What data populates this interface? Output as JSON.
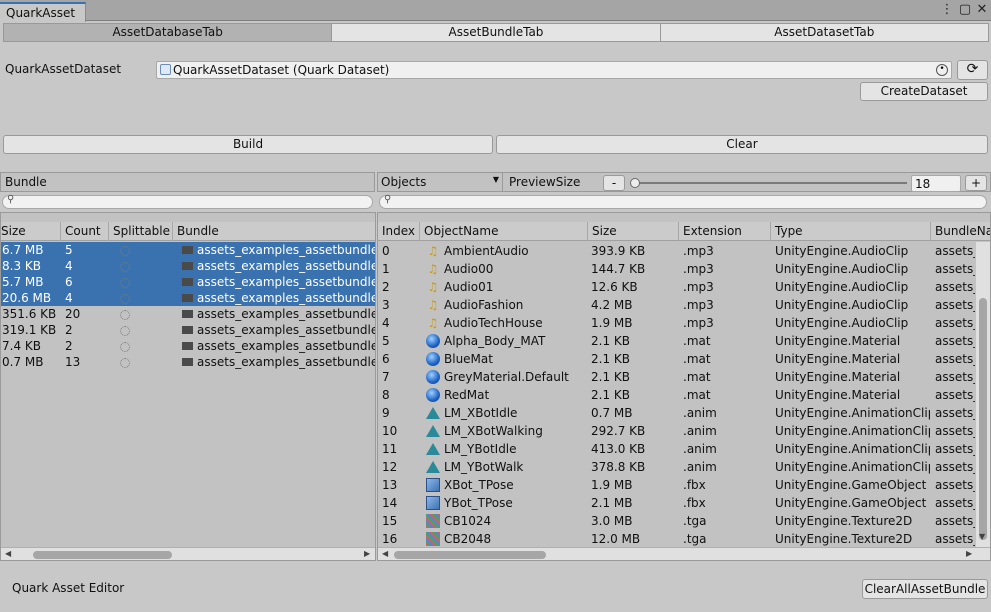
{
  "window": {
    "tab_title": "QuarkAsset",
    "menu_icon": "kebab-menu-icon",
    "maximize_icon": "maximize-icon",
    "close_icon": "close-icon"
  },
  "tabs": [
    {
      "label": "AssetDatabaseTab",
      "selected": true
    },
    {
      "label": "AssetBundleTab",
      "selected": false
    },
    {
      "label": "AssetDatasetTab",
      "selected": false
    }
  ],
  "dataset": {
    "label": "QuarkAssetDataset",
    "value": "QuarkAssetDataset (Quark Dataset)",
    "object_icon": "scriptable-object-icon",
    "picker_icon": "object-picker-icon",
    "refresh_icon": "refresh-icon"
  },
  "buttons": {
    "create_dataset": "CreateDataset",
    "build": "Build",
    "clear": "Clear",
    "clear_all": "ClearAllAssetBundle",
    "minus": "-",
    "plus": "+"
  },
  "bundle_panel": {
    "title": "Bundle",
    "search_icon": "search-icon",
    "columns": [
      "Size",
      "Count",
      "Splittable",
      "Bundle"
    ],
    "rows": [
      {
        "size": "6.7 MB",
        "count": "5",
        "bundle": "assets_examples_assetbundletest_audios",
        "selected": true
      },
      {
        "size": "8.3 KB",
        "count": "4",
        "bundle": "assets_examples_assetbundletest_materials",
        "selected": true
      },
      {
        "size": "5.7 MB",
        "count": "6",
        "bundle": "assets_examples_assetbundletest_models",
        "selected": true
      },
      {
        "size": "20.6 MB",
        "count": "4",
        "bundle": "assets_examples_assetbundletest_textures",
        "selected": true
      },
      {
        "size": "351.6 KB",
        "count": "20",
        "bundle": "assets_examples_assetbundletest_prefabs",
        "selected": false
      },
      {
        "size": "319.1 KB",
        "count": "2",
        "bundle": "assets_examples_assetbundletest_scenes",
        "selected": false
      },
      {
        "size": "7.4 KB",
        "count": "2",
        "bundle": "assets_examples_assetbundletest_scripts",
        "selected": false
      },
      {
        "size": "0.7 MB",
        "count": "13",
        "bundle": "assets_examples_assetbundletest_animations",
        "selected": false
      }
    ]
  },
  "objects_panel": {
    "dropdown_value": "Objects",
    "preview_label": "PreviewSize",
    "preview_value": "18",
    "slider_level": 0.0,
    "search_icon": "search-icon",
    "columns": [
      "Index",
      "ObjectName",
      "Size",
      "Extension",
      "Type",
      "BundleName"
    ],
    "rows": [
      {
        "index": "0",
        "name": "AmbientAudio",
        "icon": "audio",
        "size": "393.9 KB",
        "ext": ".mp3",
        "type": "UnityEngine.AudioClip",
        "bundle": "assets_examples"
      },
      {
        "index": "1",
        "name": "Audio00",
        "icon": "audio",
        "size": "144.7 KB",
        "ext": ".mp3",
        "type": "UnityEngine.AudioClip",
        "bundle": "assets_examples"
      },
      {
        "index": "2",
        "name": "Audio01",
        "icon": "audio",
        "size": "12.6 KB",
        "ext": ".mp3",
        "type": "UnityEngine.AudioClip",
        "bundle": "assets_examples"
      },
      {
        "index": "3",
        "name": "AudioFashion",
        "icon": "audio",
        "size": "4.2 MB",
        "ext": ".mp3",
        "type": "UnityEngine.AudioClip",
        "bundle": "assets_examples"
      },
      {
        "index": "4",
        "name": "AudioTechHouse",
        "icon": "audio",
        "size": "1.9 MB",
        "ext": ".mp3",
        "type": "UnityEngine.AudioClip",
        "bundle": "assets_examples"
      },
      {
        "index": "5",
        "name": "Alpha_Body_MAT",
        "icon": "material",
        "size": "2.1 KB",
        "ext": ".mat",
        "type": "UnityEngine.Material",
        "bundle": "assets_examples"
      },
      {
        "index": "6",
        "name": "BlueMat",
        "icon": "material",
        "size": "2.1 KB",
        "ext": ".mat",
        "type": "UnityEngine.Material",
        "bundle": "assets_examples"
      },
      {
        "index": "7",
        "name": "GreyMaterial.Default",
        "icon": "material",
        "size": "2.1 KB",
        "ext": ".mat",
        "type": "UnityEngine.Material",
        "bundle": "assets_examples"
      },
      {
        "index": "8",
        "name": "RedMat",
        "icon": "material",
        "size": "2.1 KB",
        "ext": ".mat",
        "type": "UnityEngine.Material",
        "bundle": "assets_examples"
      },
      {
        "index": "9",
        "name": "LM_XBotIdle",
        "icon": "anim",
        "size": "0.7 MB",
        "ext": ".anim",
        "type": "UnityEngine.AnimationClip",
        "bundle": "assets_examples"
      },
      {
        "index": "10",
        "name": "LM_XBotWalking",
        "icon": "anim",
        "size": "292.7 KB",
        "ext": ".anim",
        "type": "UnityEngine.AnimationClip",
        "bundle": "assets_examples"
      },
      {
        "index": "11",
        "name": "LM_YBotIdle",
        "icon": "anim",
        "size": "413.0 KB",
        "ext": ".anim",
        "type": "UnityEngine.AnimationClip",
        "bundle": "assets_examples"
      },
      {
        "index": "12",
        "name": "LM_YBotWalk",
        "icon": "anim",
        "size": "378.8 KB",
        "ext": ".anim",
        "type": "UnityEngine.AnimationClip",
        "bundle": "assets_examples"
      },
      {
        "index": "13",
        "name": "XBot_TPose",
        "icon": "model",
        "size": "1.9 MB",
        "ext": ".fbx",
        "type": "UnityEngine.GameObject",
        "bundle": "assets_examples"
      },
      {
        "index": "14",
        "name": "YBot_TPose",
        "icon": "model",
        "size": "2.1 MB",
        "ext": ".fbx",
        "type": "UnityEngine.GameObject",
        "bundle": "assets_examples"
      },
      {
        "index": "15",
        "name": "CB1024",
        "icon": "texture",
        "size": "3.0 MB",
        "ext": ".tga",
        "type": "UnityEngine.Texture2D",
        "bundle": "assets_examples"
      },
      {
        "index": "16",
        "name": "CB2048",
        "icon": "texture",
        "size": "12.0 MB",
        "ext": ".tga",
        "type": "UnityEngine.Texture2D",
        "bundle": "assets_examples"
      }
    ]
  },
  "footer": {
    "label": "Quark Asset Editor"
  },
  "colors": {
    "selection": "#3a72b0",
    "background": "#c8c8c8"
  }
}
